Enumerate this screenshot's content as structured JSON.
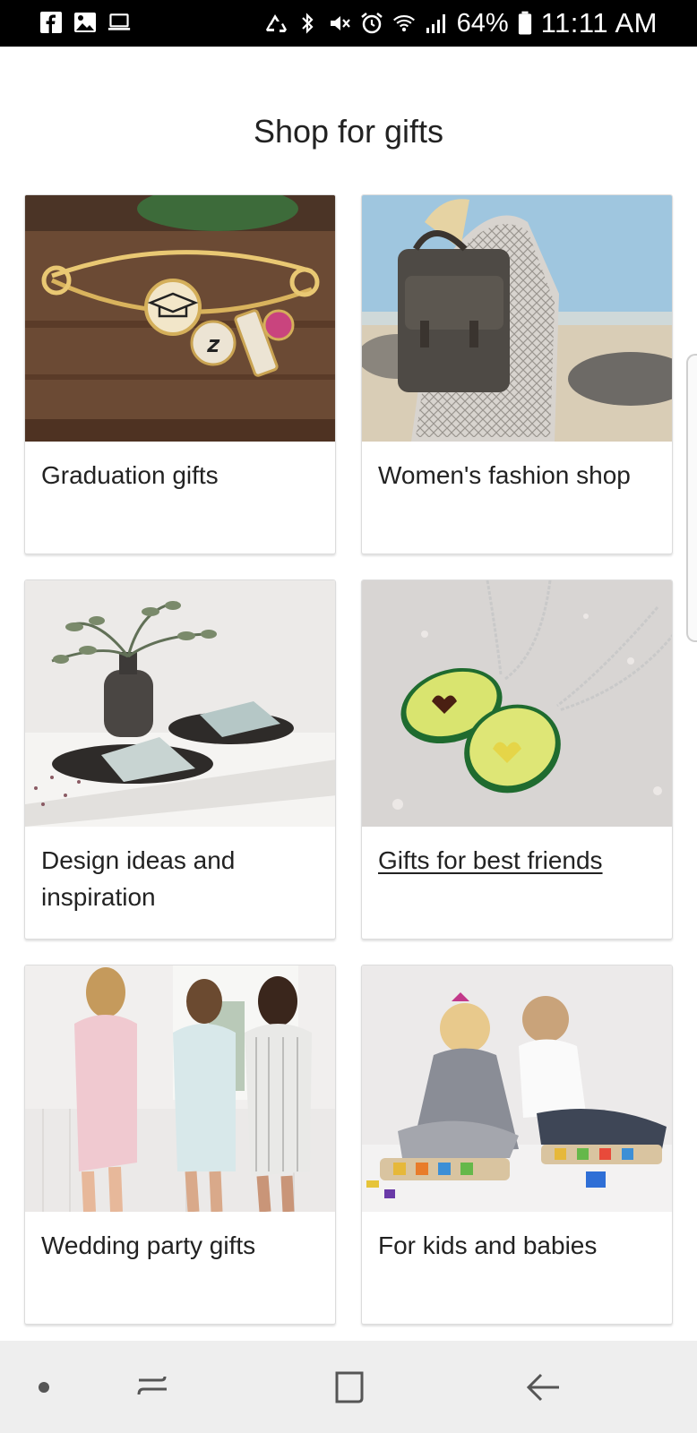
{
  "status_bar": {
    "battery": "64%",
    "time": "11:11 AM",
    "icons": [
      "facebook-icon",
      "gallery-icon",
      "laptop-icon",
      "recycle-icon",
      "bluetooth-icon",
      "mute-icon",
      "alarm-icon",
      "wifi-icon",
      "signal-icon",
      "battery-icon"
    ]
  },
  "page": {
    "title": "Shop for gifts"
  },
  "cards": [
    {
      "label": "Graduation gifts",
      "image": "gold bracelet with graduation cap charm"
    },
    {
      "label": "Women's fashion shop",
      "image": "woman wearing leather backpack at beach"
    },
    {
      "label": "Design ideas and inspiration",
      "image": "table setting with plates and greenery"
    },
    {
      "label": "Gifts for best friends",
      "image": "avocado halves necklaces"
    },
    {
      "label": "Wedding party gifts",
      "image": "women in robes"
    },
    {
      "label": "For kids and babies",
      "image": "children with name puzzles"
    }
  ],
  "nav_bar": {
    "icons": [
      "dot-icon",
      "recent-apps-icon",
      "home-icon",
      "back-icon"
    ]
  },
  "colors": {
    "status_bar_bg": "#000000",
    "nav_bar_bg": "#eeeeee",
    "text": "#222222",
    "card_border": "#dcdcdc"
  }
}
